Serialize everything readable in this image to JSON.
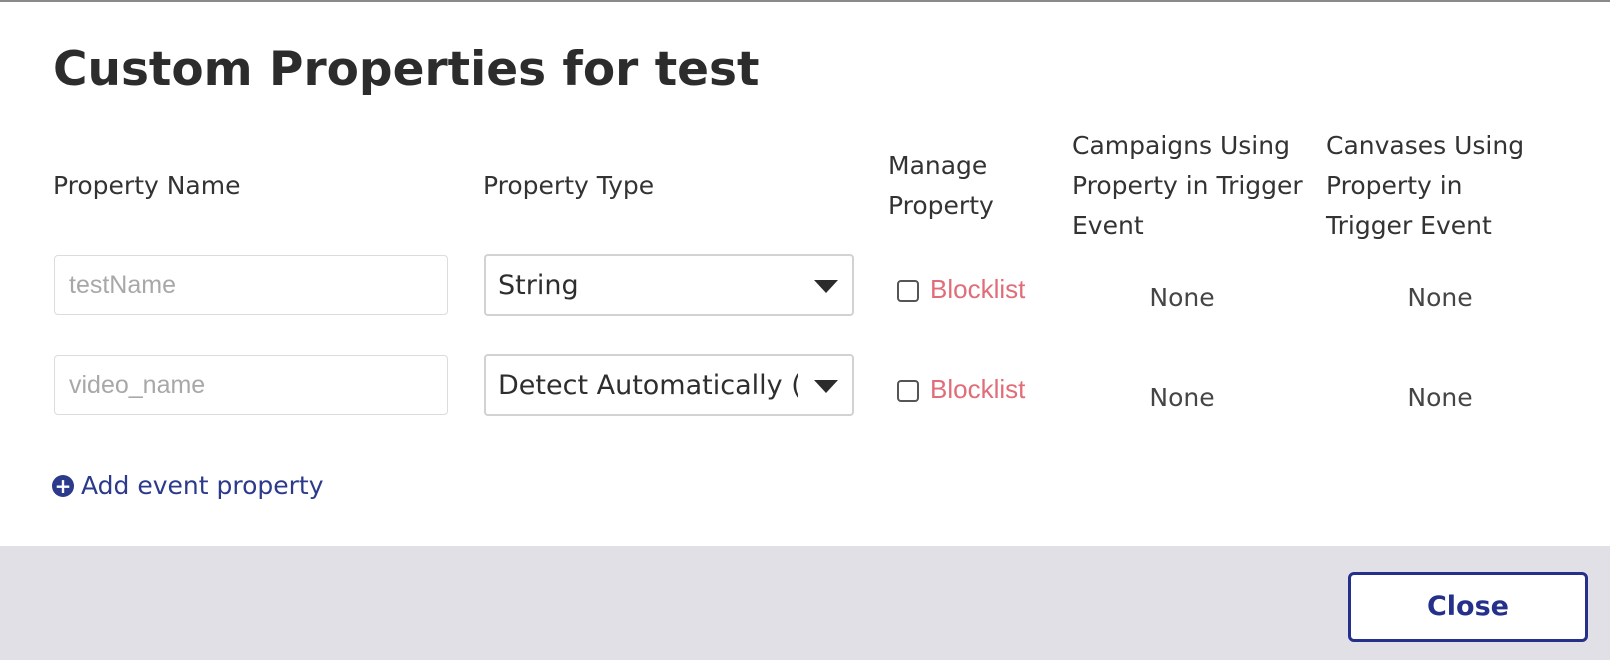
{
  "modal": {
    "title": "Custom Properties for test",
    "close_label": "Close"
  },
  "columns": {
    "name": "Property Name",
    "type": "Property Type",
    "manage": "Manage Property",
    "campaigns": "Campaigns Using Property in Trigger Event",
    "canvases": "Canvases Using Property in Trigger Event"
  },
  "rows": [
    {
      "name_placeholder": "testName",
      "type": "String",
      "blocklist_label": "Blocklist",
      "blocklisted": false,
      "campaigns": "None",
      "canvases": "None"
    },
    {
      "name_placeholder": "video_name",
      "type": "Detect Automatically (",
      "blocklist_label": "Blocklist",
      "blocklisted": false,
      "campaigns": "None",
      "canvases": "None"
    }
  ],
  "add_property_label": "Add event property",
  "icons": {
    "add": "plus-circle-icon",
    "dropdown": "caret-down-icon"
  },
  "colors": {
    "accent": "#25308a",
    "blocklist": "#e06d77",
    "footer": "#e0e0e6"
  }
}
